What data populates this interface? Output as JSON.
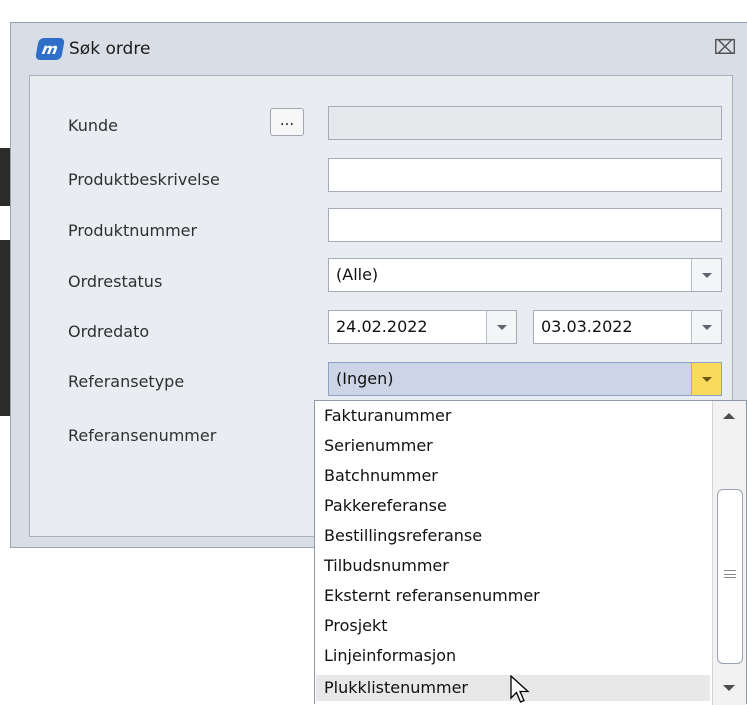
{
  "dialog": {
    "title": "Søk ordre",
    "app_icon_text": "m",
    "close_glyph": "⌧"
  },
  "form": {
    "kunde_label": "Kunde",
    "kunde_button": "...",
    "kunde_value": "",
    "produktbeskrivelse_label": "Produktbeskrivelse",
    "produktbeskrivelse_value": "",
    "produktnummer_label": "Produktnummer",
    "produktnummer_value": "",
    "ordrestatus_label": "Ordrestatus",
    "ordrestatus_value": "(Alle)",
    "ordredato_label": "Ordredato",
    "ordredato_from": "24.02.2022",
    "ordredato_to": "03.03.2022",
    "referansetype_label": "Referansetype",
    "referansetype_value": "(Ingen)",
    "referansenummer_label": "Referansenummer"
  },
  "dropdown": {
    "items": [
      "Fakturanummer",
      "Serienummer",
      "Batchnummer",
      "Pakkereferanse",
      "Bestillingsreferanse",
      "Tilbudsnummer",
      "Eksternt referansenummer",
      "Prosjekt",
      "Linjeinformasjon",
      "Plukklistenummer"
    ],
    "hovered_item": "Plukklistenummer"
  },
  "colors": {
    "selected_combo": "#cbd5e5",
    "combo_arrow_active": "#fbd95a",
    "app_icon": "#2f6fc9"
  }
}
